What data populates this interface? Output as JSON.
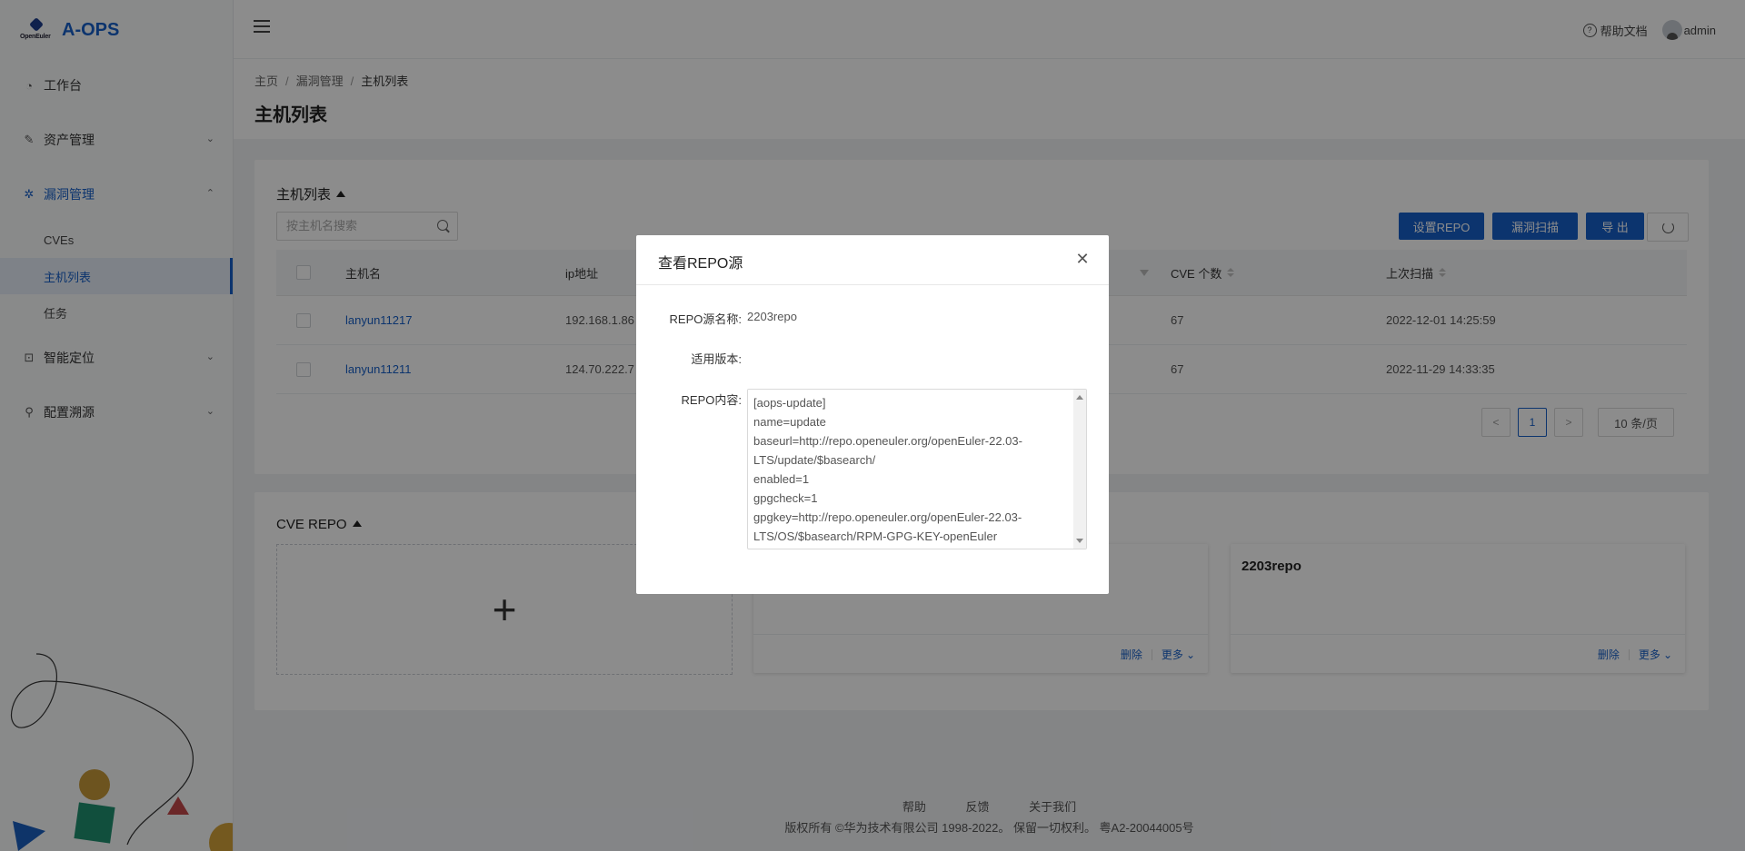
{
  "app": {
    "logo_sub": "OpenEuler",
    "name": "A-OPS"
  },
  "sidebar": {
    "items": [
      {
        "label": "工作台",
        "icon": "dashboard-icon"
      },
      {
        "label": "资产管理",
        "icon": "edit-icon"
      },
      {
        "label": "漏洞管理",
        "icon": "bug-icon"
      },
      {
        "label": "智能定位",
        "icon": "locate-icon"
      },
      {
        "label": "配置溯源",
        "icon": "tree-icon"
      }
    ],
    "vuln_children": [
      {
        "label": "CVEs"
      },
      {
        "label": "主机列表"
      },
      {
        "label": "任务"
      }
    ]
  },
  "header": {
    "help": "帮助文档",
    "user": "admin"
  },
  "breadcrumb": {
    "home": "主页",
    "section": "漏洞管理",
    "current": "主机列表"
  },
  "page": {
    "title": "主机列表"
  },
  "host_card": {
    "title": "主机列表",
    "search_placeholder": "按主机名搜索",
    "buttons": {
      "set_repo": "设置REPO",
      "scan": "漏洞扫描",
      "export": "导 出"
    },
    "columns": {
      "host": "主机名",
      "ip": "ip地址",
      "cve_count": "CVE 个数",
      "last_scan": "上次扫描"
    },
    "rows": [
      {
        "host": "lanyun11217",
        "ip": "192.168.1.86",
        "cve": "67",
        "last_scan": "2022-12-01 14:25:59"
      },
      {
        "host": "lanyun11211",
        "ip": "124.70.222.7",
        "cve": "67",
        "last_scan": "2022-11-29 14:33:35"
      }
    ],
    "pager": {
      "prev": "<",
      "page": "1",
      "next": ">",
      "size": "10 条/页"
    }
  },
  "repo_card": {
    "title": "CVE REPO",
    "add": "+",
    "tiles": [
      {
        "name": "",
        "delete": "删除",
        "more": "更多"
      },
      {
        "name": "2203repo",
        "delete": "删除",
        "more": "更多"
      }
    ]
  },
  "footer": {
    "links": [
      "帮助",
      "反馈",
      "关于我们"
    ],
    "copyright": "版权所有 ©华为技术有限公司 1998-2022。 保留一切权利。 粤A2-20044005号"
  },
  "modal": {
    "title": "查看REPO源",
    "name_label": "REPO源名称:",
    "name_value": "2203repo",
    "version_label": "适用版本:",
    "version_value": "",
    "content_label": "REPO内容:",
    "content": "[aops-update]\nname=update\nbaseurl=http://repo.openeuler.org/openEuler-22.03-LTS/update/$basearch/\nenabled=1\ngpgcheck=1\ngpgkey=http://repo.openeuler.org/openEuler-22.03-LTS/OS/$basearch/RPM-GPG-KEY-openEuler"
  },
  "colors": {
    "primary": "#1760c8",
    "mask": "rgba(0,0,0,0.45)"
  }
}
